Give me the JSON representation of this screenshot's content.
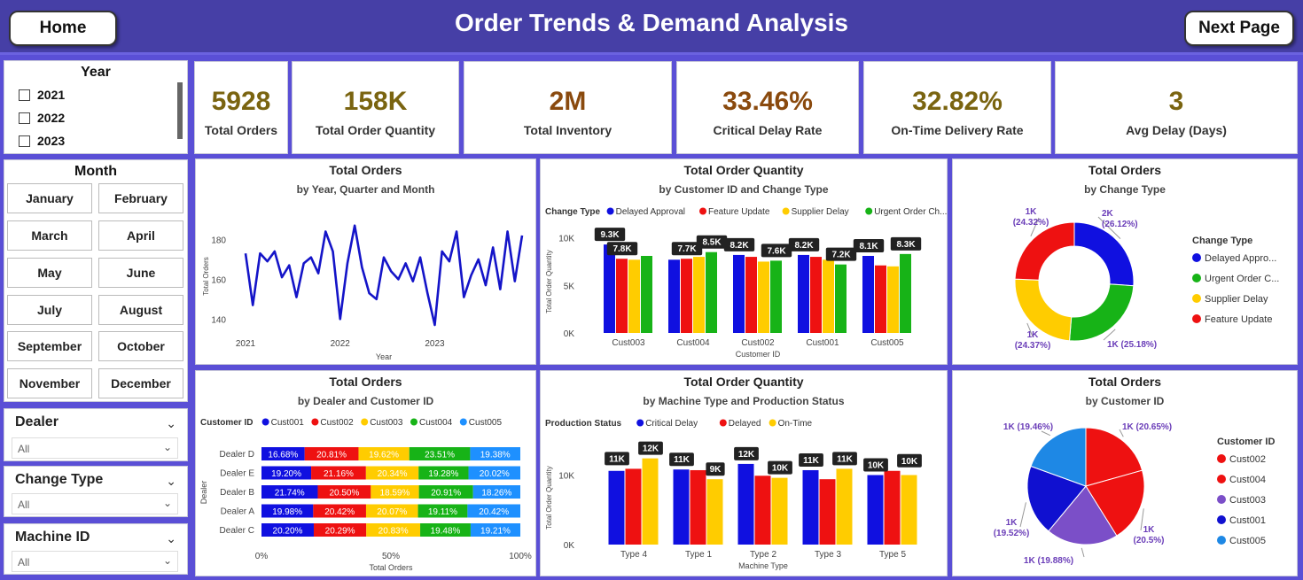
{
  "header": {
    "title": "Order Trends & Demand Analysis",
    "home_label": "Home",
    "next_label": "Next Page"
  },
  "year_slicer": {
    "title": "Year",
    "options": [
      "2021",
      "2022",
      "2023"
    ]
  },
  "month_slicer": {
    "title": "Month",
    "options": [
      "January",
      "February",
      "March",
      "April",
      "May",
      "June",
      "July",
      "August",
      "September",
      "October",
      "November",
      "December"
    ]
  },
  "dropdowns": {
    "dealer": {
      "title": "Dealer",
      "value": "All"
    },
    "change_type": {
      "title": "Change Type",
      "value": "All"
    },
    "machine_id": {
      "title": "Machine ID",
      "value": "All"
    }
  },
  "kpis": [
    {
      "value": "5928",
      "label": "Total Orders",
      "color": "#7a6410"
    },
    {
      "value": "158K",
      "label": "Total Order Quantity",
      "color": "#7a6410"
    },
    {
      "value": "2M",
      "label": "Total Inventory",
      "color": "#8a4a0e"
    },
    {
      "value": "33.46%",
      "label": "Critical Delay Rate",
      "color": "#8a4a0e"
    },
    {
      "value": "32.82%",
      "label": "On-Time Delivery Rate",
      "color": "#7a6410"
    },
    {
      "value": "3",
      "label": "Avg Delay (Days)",
      "color": "#7a6410"
    }
  ],
  "chart_data": [
    {
      "id": "line",
      "type": "line",
      "title": "Total Orders",
      "subtitle": "by Year, Quarter and Month",
      "xlabel": "Year",
      "ylabel": "Total Orders",
      "x_ticks": [
        "2021",
        "2022",
        "2023"
      ],
      "y_ticks": [
        140,
        160,
        180
      ],
      "ylim": [
        133,
        190
      ],
      "values": [
        173,
        147,
        173,
        169,
        174,
        161,
        167,
        151,
        168,
        171,
        163,
        184,
        174,
        140,
        168,
        187,
        166,
        153,
        150,
        171,
        164,
        160,
        168,
        159,
        171,
        153,
        137,
        174,
        169,
        184,
        151,
        162,
        170,
        157,
        176,
        155,
        184,
        159,
        182
      ]
    },
    {
      "id": "qty_customer",
      "type": "bar",
      "title": "Total Order Quantity",
      "subtitle": "by Customer ID and Change Type",
      "legend_title": "Change Type",
      "xlabel": "Customer ID",
      "ylabel": "Total Order Quantity",
      "y_ticks": [
        "0K",
        "5K",
        "10K"
      ],
      "y_tick_values": [
        0,
        5000,
        10000
      ],
      "ylim": [
        0,
        10800
      ],
      "categories": [
        "Cust003",
        "Cust004",
        "Cust002",
        "Cust001",
        "Cust005"
      ],
      "series": [
        {
          "name": "Delayed Approval",
          "color": "#1010e0",
          "values": [
            9300,
            7700,
            8200,
            8200,
            8100
          ]
        },
        {
          "name": "Feature Update",
          "color": "#ee1111",
          "values": [
            7800,
            7800,
            8000,
            8000,
            7100
          ]
        },
        {
          "name": "Supplier Delay",
          "color": "#ffcc00",
          "values": [
            7700,
            8000,
            7500,
            7700,
            7000
          ]
        },
        {
          "name": "Urgent Order Ch...",
          "color": "#17b317",
          "values": [
            8100,
            8500,
            7600,
            7200,
            8300
          ]
        }
      ],
      "data_labels": [
        {
          "text": "9.3K",
          "cat": 0,
          "series": 0,
          "value": 9300
        },
        {
          "text": "7.8K",
          "cat": 0,
          "series": 1,
          "value": 7800
        },
        {
          "text": "7.7K",
          "cat": 1,
          "series": 1,
          "value": 7800
        },
        {
          "text": "8.5K",
          "cat": 1,
          "series": 3,
          "value": 8500
        },
        {
          "text": "8.2K",
          "cat": 2,
          "series": 0,
          "value": 8200
        },
        {
          "text": "7.6K",
          "cat": 2,
          "series": 3,
          "value": 7600
        },
        {
          "text": "8.2K",
          "cat": 3,
          "series": 0,
          "value": 8200
        },
        {
          "text": "7.2K",
          "cat": 3,
          "series": 3,
          "value": 7200
        },
        {
          "text": "8.1K",
          "cat": 4,
          "series": 0,
          "value": 8100
        },
        {
          "text": "8.3K",
          "cat": 4,
          "series": 3,
          "value": 8300
        }
      ]
    },
    {
      "id": "donut",
      "type": "pie",
      "title": "Total Orders",
      "subtitle": "by Change Type",
      "legend_title": "Change Type",
      "slices": [
        {
          "name": "Delayed Appro...",
          "color": "#1010e0",
          "pct": 26.12,
          "label": "2K\n(26.12%)"
        },
        {
          "name": "Urgent Order C...",
          "color": "#17b317",
          "pct": 25.18,
          "label": "1K (25.18%)"
        },
        {
          "name": "Supplier Delay",
          "color": "#ffcc00",
          "pct": 24.37,
          "label": "1K\n(24.37%)"
        },
        {
          "name": "Feature Update",
          "color": "#ee1111",
          "pct": 24.32,
          "label": "1K\n(24.32%)"
        }
      ]
    },
    {
      "id": "dealer_stack",
      "type": "bar",
      "stacked": "100%",
      "title": "Total Orders",
      "subtitle": "by Dealer and Customer ID",
      "legend_title": "Customer ID",
      "xlabel": "Total Orders",
      "ylabel": "Dealer",
      "x_ticks": [
        "0%",
        "50%",
        "100%"
      ],
      "categories": [
        "Dealer D",
        "Dealer E",
        "Dealer B",
        "Dealer A",
        "Dealer C"
      ],
      "series": [
        {
          "name": "Cust001",
          "color": "#1010e0",
          "values": [
            16.68,
            19.2,
            21.74,
            19.98,
            20.2
          ],
          "labels": [
            "16.68%",
            "19.20%",
            "21.74%",
            "19.98%",
            "20.20%"
          ]
        },
        {
          "name": "Cust002",
          "color": "#ee1111",
          "values": [
            20.81,
            21.16,
            20.5,
            20.42,
            20.29
          ],
          "labels": [
            "20.81%",
            "21.16%",
            "20.50%",
            "20.42%",
            "20.29%"
          ]
        },
        {
          "name": "Cust003",
          "color": "#ffcc00",
          "values": [
            19.62,
            20.34,
            18.59,
            20.07,
            20.83
          ],
          "labels": [
            "19.62%",
            "20.34%",
            "18.59%",
            "20.07%",
            "20.83%"
          ]
        },
        {
          "name": "Cust004",
          "color": "#17b317",
          "values": [
            23.51,
            19.28,
            20.91,
            19.11,
            19.48
          ],
          "labels": [
            "23.51%",
            "19.28%",
            "20.91%",
            "19.11%",
            "19.48%"
          ]
        },
        {
          "name": "Cust005",
          "color": "#1e90ff",
          "values": [
            19.38,
            20.02,
            18.26,
            20.42,
            19.21
          ],
          "labels": [
            "19.38%",
            "20.02%",
            "18.26%",
            "20.42%",
            "19.21%"
          ]
        }
      ]
    },
    {
      "id": "qty_machine",
      "type": "bar",
      "title": "Total Order Quantity",
      "subtitle": "by Machine Type and Production Status",
      "legend_title": "Production Status",
      "xlabel": "Machine Type",
      "ylabel": "Total Order Quantity",
      "y_ticks": [
        "0K",
        "10K"
      ],
      "y_tick_values": [
        0,
        10000
      ],
      "ylim": [
        0,
        13500
      ],
      "categories": [
        "Type 4",
        "Type 1",
        "Type 2",
        "Type 3",
        "Type 5"
      ],
      "series": [
        {
          "name": "Critical Delay",
          "color": "#1010e0",
          "values": [
            10600,
            10800,
            11600,
            10700,
            10000
          ]
        },
        {
          "name": "Delayed",
          "color": "#ee1111",
          "values": [
            10900,
            10700,
            9900,
            9400,
            10600
          ]
        },
        {
          "name": "On-Time",
          "color": "#ffcc00",
          "values": [
            12400,
            9400,
            9600,
            10900,
            10000
          ]
        }
      ],
      "data_labels": [
        {
          "text": "11K",
          "cat": 0,
          "series": 0,
          "value": 10900
        },
        {
          "text": "12K",
          "cat": 0,
          "series": 2,
          "value": 12400
        },
        {
          "text": "11K",
          "cat": 1,
          "series": 0,
          "value": 10800
        },
        {
          "text": "9K",
          "cat": 1,
          "series": 2,
          "value": 9400
        },
        {
          "text": "12K",
          "cat": 2,
          "series": 0,
          "value": 11600
        },
        {
          "text": "10K",
          "cat": 2,
          "series": 2,
          "value": 9600
        },
        {
          "text": "11K",
          "cat": 3,
          "series": 0,
          "value": 10700
        },
        {
          "text": "11K",
          "cat": 3,
          "series": 2,
          "value": 10900
        },
        {
          "text": "10K",
          "cat": 4,
          "series": 0,
          "value": 10000
        },
        {
          "text": "10K",
          "cat": 4,
          "series": 2,
          "value": 10600
        }
      ]
    },
    {
      "id": "pie_customer",
      "type": "pie",
      "title": "Total Orders",
      "subtitle": "by Customer ID",
      "legend_title": "Customer ID",
      "slices": [
        {
          "name": "Cust002",
          "color": "#ee1111",
          "pct": 20.65,
          "label": "1K (20.65%)"
        },
        {
          "name": "Cust004",
          "color": "#ee1111",
          "pct": 20.5,
          "label": "1K\n(20.5%)"
        },
        {
          "name": "Cust003",
          "color": "#7b4fc8",
          "pct": 19.88,
          "label": "1K (19.88%)"
        },
        {
          "name": "Cust001",
          "color": "#1010d0",
          "pct": 19.52,
          "label": "1K\n(19.52%)"
        },
        {
          "name": "Cust005",
          "color": "#1e88e5",
          "pct": 19.46,
          "label": "1K (19.46%)"
        }
      ]
    }
  ]
}
